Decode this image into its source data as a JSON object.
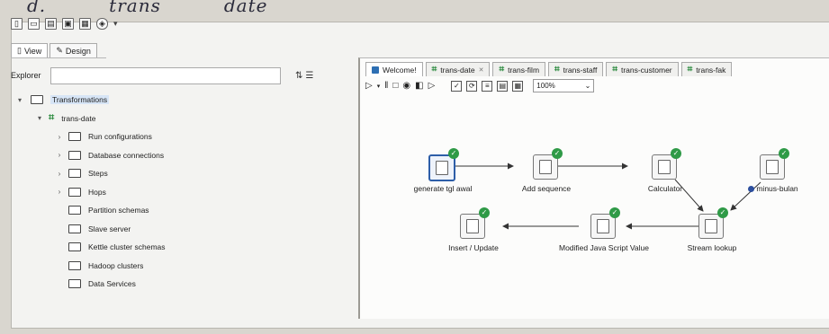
{
  "header": {
    "handwriting": [
      "d.",
      "trans",
      "date"
    ]
  },
  "left_panel": {
    "tabs": [
      {
        "label": "View",
        "active": true
      },
      {
        "label": "Design",
        "active": false
      }
    ],
    "explorer_label": "Explorer",
    "explorer_value": "",
    "tree": [
      {
        "label": "Transformations",
        "selected": true
      },
      {
        "label": "trans-date"
      },
      {
        "label": "Run configurations"
      },
      {
        "label": "Database connections"
      },
      {
        "label": "Steps"
      },
      {
        "label": "Hops"
      },
      {
        "label": "Partition schemas"
      },
      {
        "label": "Slave server"
      },
      {
        "label": "Kettle cluster schemas"
      },
      {
        "label": "Hadoop clusters"
      },
      {
        "label": "Data Services"
      }
    ]
  },
  "editor": {
    "tabs": [
      {
        "label": "Welcome!",
        "active": true
      },
      {
        "label": "trans-date",
        "active": false
      },
      {
        "label": "trans-film",
        "active": false
      },
      {
        "label": "trans-staff",
        "active": false
      },
      {
        "label": "trans-customer",
        "active": false
      },
      {
        "label": "trans-fak",
        "active": false
      }
    ],
    "zoom": "100%"
  },
  "steps": [
    {
      "label": "generate tgl awal",
      "status": "ok",
      "selected": true
    },
    {
      "label": "Add sequence",
      "status": "ok"
    },
    {
      "label": "Calculator",
      "status": "ok"
    },
    {
      "label": "minus-bulan",
      "status": "ok"
    },
    {
      "label": "Stream lookup",
      "status": "ok"
    },
    {
      "label": "Modified Java Script Value",
      "status": "ok"
    },
    {
      "label": "Insert / Update",
      "status": "ok"
    }
  ],
  "colors": {
    "ok_badge": "#2f9a47",
    "selection": "#2d5ea8"
  }
}
